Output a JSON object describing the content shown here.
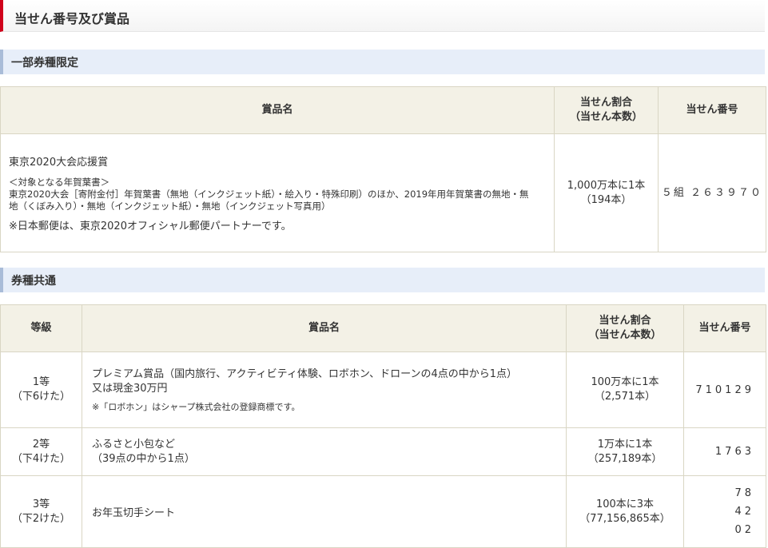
{
  "title": "当せん番号及び賞品",
  "section1": {
    "heading": "一部券種限定",
    "headers": {
      "prize": "賞品名",
      "ratio": "当せん割合",
      "count": "（当せん本数）",
      "number": "当せん番号"
    },
    "row": {
      "name": "東京2020大会応援賞",
      "target_label": "＜対象となる年賀葉書＞",
      "target_text": "東京2020大会［寄附金付］年賀葉書（無地（インクジェット紙）・絵入り・特殊印刷）のほか、2019年用年賀葉書の無地・無地（くぼみ入り）・無地（インクジェット紙）・無地（インクジェット写真用）",
      "note": "※日本郵便は、東京2020オフィシャル郵便パートナーです。",
      "ratio": "1,000万本に1本",
      "count": "（194本）",
      "number": "５組 ２６３９７０"
    }
  },
  "section2": {
    "heading": "券種共通",
    "headers": {
      "grade": "等級",
      "prize": "賞品名",
      "ratio": "当せん割合",
      "count": "（当せん本数）",
      "number": "当せん番号"
    },
    "rows": [
      {
        "grade": "1等",
        "digits": "（下6けた）",
        "prize1": "プレミアム賞品（国内旅行、アクティビティ体験、ロボホン、ドローンの4点の中から1点）",
        "prize2": "又は現金30万円",
        "note": "※「ロボホン」はシャープ株式会社の登録商標です。",
        "ratio": "100万本に1本",
        "count": "（2,571本）",
        "numbers": [
          "710129"
        ]
      },
      {
        "grade": "2等",
        "digits": "（下4けた）",
        "prize1": "ふるさと小包など",
        "prize2": "（39点の中から1点）",
        "ratio": "1万本に1本",
        "count": "（257,189本）",
        "numbers": [
          "1763"
        ]
      },
      {
        "grade": "3等",
        "digits": "（下2けた）",
        "prize1": "お年玉切手シート",
        "ratio": "100本に3本",
        "count": "（77,156,865本）",
        "numbers": [
          "78",
          "42",
          "02"
        ]
      }
    ]
  }
}
